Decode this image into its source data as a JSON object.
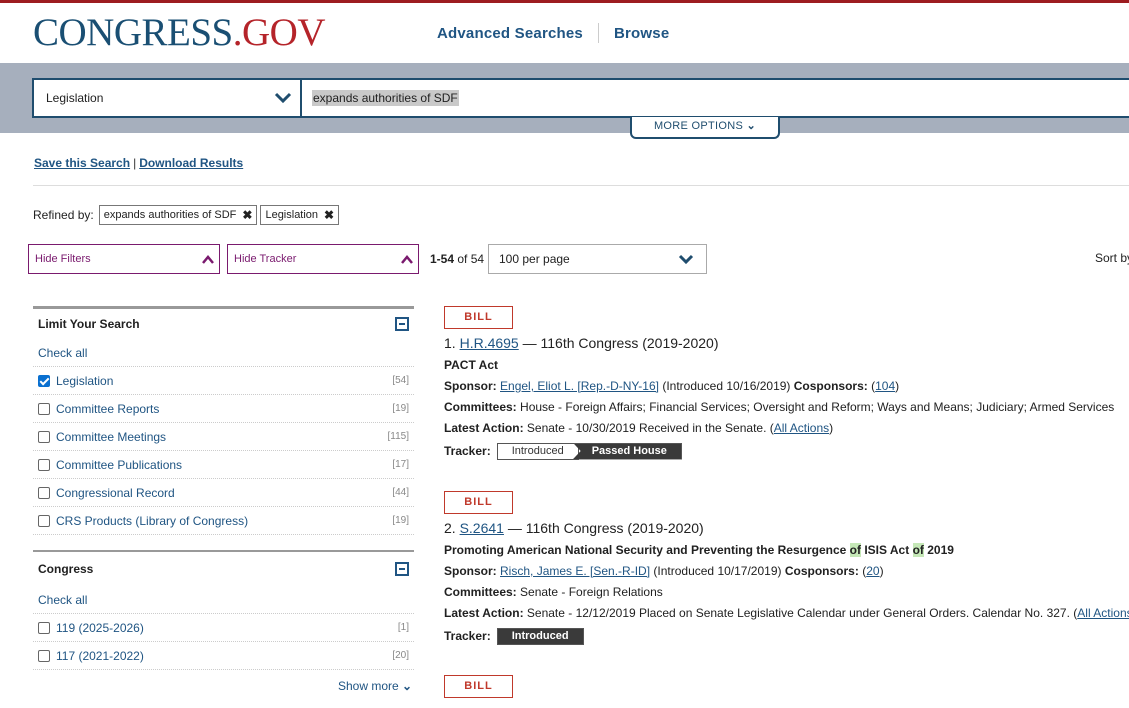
{
  "header": {
    "logo_main": "CONGRESS",
    "logo_dot": ".",
    "logo_gov": "GOV",
    "nav": [
      "Advanced Searches",
      "Browse"
    ]
  },
  "search": {
    "collection": "Legislation",
    "query": "expands authorities of SDF",
    "more_options": "MORE OPTIONS"
  },
  "actions": {
    "save": "Save this Search",
    "sep": "|",
    "download": "Download Results"
  },
  "refined": {
    "label": "Refined by:",
    "chips": [
      "expands authorities of SDF",
      "Legislation"
    ]
  },
  "controls": {
    "hide_filters": "Hide Filters",
    "hide_tracker": "Hide Tracker",
    "count_range": "1-54",
    "count_of": "of 54",
    "per_page": "100 per page",
    "sort_label": "Sort by"
  },
  "facets": {
    "limit": {
      "title": "Limit Your Search",
      "check_all": "Check all",
      "items": [
        {
          "label": "Legislation",
          "count": "[54]",
          "checked": true
        },
        {
          "label": "Committee Reports",
          "count": "[19]",
          "checked": false
        },
        {
          "label": "Committee Meetings",
          "count": "[115]",
          "checked": false
        },
        {
          "label": "Committee Publications",
          "count": "[17]",
          "checked": false
        },
        {
          "label": "Congressional Record",
          "count": "[44]",
          "checked": false
        },
        {
          "label": "CRS Products (Library of Congress)",
          "count": "[19]",
          "checked": false
        }
      ]
    },
    "congress": {
      "title": "Congress",
      "check_all": "Check all",
      "items": [
        {
          "label": "119 (2025-2026)",
          "count": "[1]",
          "checked": false
        },
        {
          "label": "117 (2021-2022)",
          "count": "[20]",
          "checked": false
        }
      ],
      "show_more": "Show more"
    }
  },
  "results": [
    {
      "tag": "BILL",
      "num": "1.",
      "bill": "H.R.4695",
      "congress": "— 116th Congress (2019-2020)",
      "title": "PACT Act",
      "sponsor": "Engel, Eliot L. [Rep.-D-NY-16]",
      "introduced": "(Introduced 10/16/2019)",
      "cosponsors": "104",
      "committees": "House - Foreign Affairs; Financial Services; Oversight and Reform; Ways and Means; Judiciary; Armed Services",
      "latest_action": "Senate - 10/30/2019 Received in the Senate.",
      "all_actions": "All Actions",
      "tracker": [
        {
          "label": "Introduced",
          "active": false
        },
        {
          "label": "Passed House",
          "active": true
        }
      ]
    },
    {
      "tag": "BILL",
      "num": "2.",
      "bill": "S.2641",
      "congress": "— 116th Congress (2019-2020)",
      "title_a": "Promoting American National Security and Preventing the Resurgence ",
      "title_hl1": "of",
      "title_b": " ISIS Act ",
      "title_hl2": "of",
      "title_c": " 2019",
      "sponsor": "Risch, James E. [Sen.-R-ID]",
      "introduced": "(Introduced 10/17/2019)",
      "cosponsors": "20",
      "committees": "Senate - Foreign Relations",
      "latest_action": "Senate - 12/12/2019 Placed on Senate Legislative Calendar under General Orders. Calendar No. 327.",
      "all_actions": "All Actions",
      "tracker": [
        {
          "label": "Introduced",
          "active": true
        }
      ]
    },
    {
      "tag": "BILL"
    }
  ],
  "labels": {
    "sponsor": "Sponsor:",
    "cosponsors": "Cosponsors:",
    "committees": "Committees:",
    "latest_action": "Latest Action:",
    "tracker": "Tracker:"
  }
}
